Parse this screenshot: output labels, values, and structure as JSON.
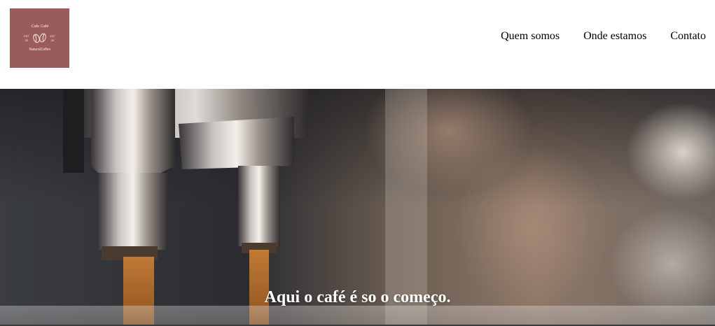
{
  "header": {
    "logo": {
      "top_text": "Cafe Café",
      "left_text": "EST",
      "left_number": "20",
      "right_text": "EST",
      "right_number": "20",
      "bottom_text": "NaturalCoffee",
      "background_color": "#9a5c5b"
    },
    "nav": {
      "items": [
        {
          "label": "Quem somos"
        },
        {
          "label": "Onde estamos"
        },
        {
          "label": "Contato"
        }
      ]
    }
  },
  "hero": {
    "title": "Aqui o café é so o começo."
  }
}
